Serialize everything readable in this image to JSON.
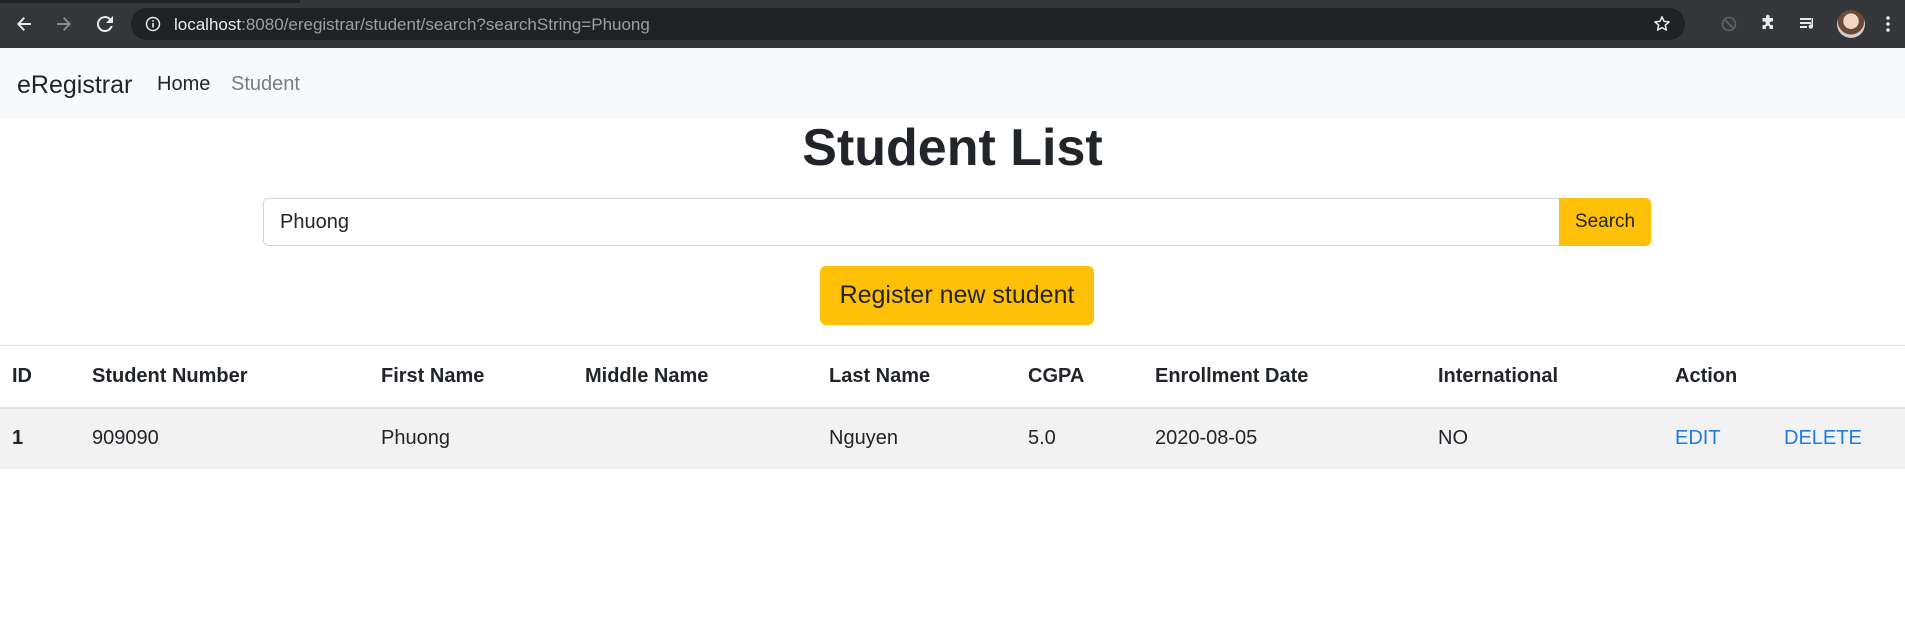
{
  "browser": {
    "url_host": "localhost",
    "url_rest": ":8080/eregistrar/student/search?searchString=Phuong"
  },
  "navbar": {
    "brand": "eRegistrar",
    "links": [
      {
        "label": "Home"
      },
      {
        "label": "Student"
      }
    ]
  },
  "page": {
    "title": "Student List"
  },
  "search": {
    "value": "Phuong",
    "button_label": "Search"
  },
  "register_button_label": "Register new student",
  "table": {
    "headers": [
      "ID",
      "Student Number",
      "First Name",
      "Middle Name",
      "Last Name",
      "CGPA",
      "Enrollment Date",
      "International",
      "Action"
    ],
    "rows": [
      {
        "id": "1",
        "student_number": "909090",
        "first_name": "Phuong",
        "middle_name": "",
        "last_name": "Nguyen",
        "cgpa": "5.0",
        "enrollment_date": "2020-08-05",
        "international": "NO",
        "edit_label": "EDIT",
        "delete_label": "DELETE"
      }
    ]
  },
  "colors": {
    "accent_yellow": "#ffc107",
    "link_blue": "#1e7bdf",
    "navbar_bg": "#f8f9fa",
    "row_stripe": "#f2f2f2"
  },
  "icons": [
    "back-arrow-icon",
    "forward-arrow-icon",
    "reload-icon",
    "info-icon",
    "star-icon",
    "extension-sync-icon",
    "puzzle-icon",
    "media-queue-icon",
    "more-vert-icon"
  ]
}
